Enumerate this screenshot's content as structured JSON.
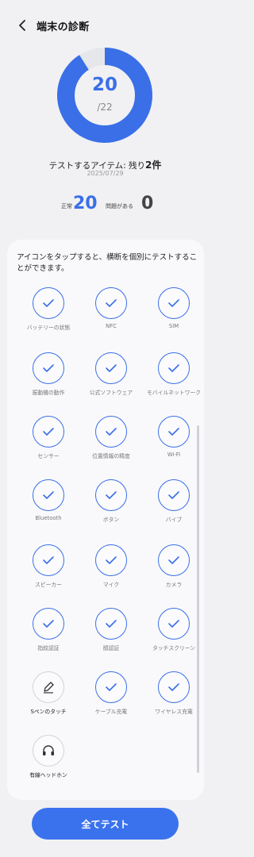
{
  "header": {
    "title": "端末の診断",
    "back_icon": "chevron-left-icon"
  },
  "summary": {
    "completed": "20",
    "total": "/22",
    "progress": 0.909,
    "remaining_prefix": "テストするアイテム: 残り",
    "remaining_count": "2件",
    "date": "2025/07/29"
  },
  "stats": {
    "normal_label": "正常",
    "normal_value": "20",
    "issue_label": "問題がある",
    "issue_value": "0"
  },
  "instructions": "アイコンをタップすると、横断を個別にテストすることができます。",
  "items": [
    {
      "label": "バッテリーの状態",
      "icon": "check-icon",
      "status": "done"
    },
    {
      "label": "NFC",
      "icon": "check-icon",
      "status": "done"
    },
    {
      "label": "SIM",
      "icon": "check-icon",
      "status": "done"
    },
    {
      "label": "振動機の動作",
      "icon": "check-icon",
      "status": "done"
    },
    {
      "label": "公式ソフトウェア",
      "icon": "check-icon",
      "status": "done"
    },
    {
      "label": "モバイルネットワーク",
      "icon": "check-icon",
      "status": "done"
    },
    {
      "label": "センサー",
      "icon": "check-icon",
      "status": "done"
    },
    {
      "label": "位置情報の精度",
      "icon": "check-icon",
      "status": "done"
    },
    {
      "label": "Wi-Fi",
      "icon": "check-icon",
      "status": "done"
    },
    {
      "label": "Bluetooth",
      "icon": "check-icon",
      "status": "done"
    },
    {
      "label": "ボタン",
      "icon": "check-icon",
      "status": "done"
    },
    {
      "label": "バイブ",
      "icon": "check-icon",
      "status": "done"
    },
    {
      "label": "スピーカー",
      "icon": "check-icon",
      "status": "done"
    },
    {
      "label": "マイク",
      "icon": "check-icon",
      "status": "done"
    },
    {
      "label": "カメラ",
      "icon": "check-icon",
      "status": "done"
    },
    {
      "label": "指紋認証",
      "icon": "check-icon",
      "status": "done"
    },
    {
      "label": "顔認証",
      "icon": "check-icon",
      "status": "done"
    },
    {
      "label": "タッチスクリーン",
      "icon": "check-icon",
      "status": "done"
    },
    {
      "label": "Sペンのタッチ",
      "icon": "pen-icon",
      "status": "pending"
    },
    {
      "label": "ケーブル充電",
      "icon": "check-icon",
      "status": "done"
    },
    {
      "label": "ワイヤレス充電",
      "icon": "check-icon",
      "status": "done"
    },
    {
      "label": "有線ヘッドホン",
      "icon": "headphones-icon",
      "status": "pending"
    }
  ],
  "button": {
    "label": "全てテスト"
  },
  "colors": {
    "accent": "#3a6fe8",
    "ring_track": "#e6e7ea",
    "background": "#f1f1f3"
  }
}
